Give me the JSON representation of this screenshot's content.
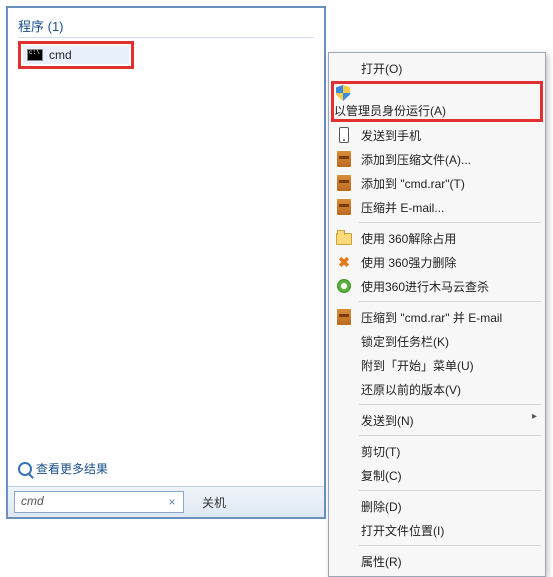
{
  "left": {
    "section_title": "程序 (1)",
    "cmd_label": "cmd",
    "see_more": "查看更多结果",
    "search_value": "cmd",
    "shutdown_label": "关机"
  },
  "ctx": {
    "open": "打开(O)",
    "run_admin": "以管理员身份运行(A)",
    "send_phone": "发送到手机",
    "add_archive": "添加到压缩文件(A)...",
    "add_rar": "添加到 \"cmd.rar\"(T)",
    "zip_email": "压缩并 E-mail...",
    "release_360": "使用 360解除占用",
    "force_del_360": "使用 360强力删除",
    "trojan_360": "使用360进行木马云查杀",
    "zip_rar_email": "压缩到 \"cmd.rar\" 并 E-mail",
    "pin_taskbar": "锁定到任务栏(K)",
    "pin_start": "附到「开始」菜单(U)",
    "restore_prev": "还原以前的版本(V)",
    "send_to": "发送到(N)",
    "cut": "剪切(T)",
    "copy": "复制(C)",
    "delete": "删除(D)",
    "open_loc": "打开文件位置(I)",
    "props": "属性(R)"
  }
}
